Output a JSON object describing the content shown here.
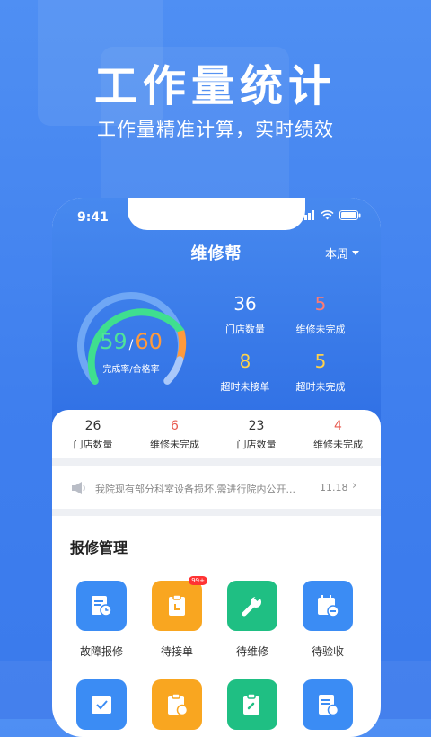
{
  "hero": {
    "title": "工作量统计",
    "subtitle": "工作量精准计算，实时绩效"
  },
  "status": {
    "time": "9:41"
  },
  "app": {
    "title": "维修帮",
    "period": "本周"
  },
  "gauge": {
    "done": "59",
    "sep": "/",
    "ok": "60",
    "label": "完成率/合格率",
    "done_fraction": 0.59,
    "ok_fraction": 0.6
  },
  "stats": [
    {
      "value": "36",
      "label": "门店数量"
    },
    {
      "value": "5",
      "label": "维修未完成"
    },
    {
      "value": "8",
      "label": "超时未接单"
    },
    {
      "value": "5",
      "label": "超时未完成"
    }
  ],
  "summary": [
    {
      "value": "26",
      "label": "门店数量"
    },
    {
      "value": "6",
      "label": "维修未完成"
    },
    {
      "value": "23",
      "label": "门店数量"
    },
    {
      "value": "4",
      "label": "维修未完成"
    }
  ],
  "notice": {
    "text": "我院现有部分科室设备损坏,需进行院内公开...",
    "date": "11.18",
    "icon": "megaphone-icon"
  },
  "section": {
    "title": "报修管理"
  },
  "grid": [
    {
      "label": "故障报修",
      "icon": "report-icon",
      "color": "#3b8cf4"
    },
    {
      "label": "待接单",
      "icon": "clipboard-icon",
      "color": "#f9a620",
      "badge": "99+"
    },
    {
      "label": "待维修",
      "icon": "wrench-icon",
      "color": "#1fbf83"
    },
    {
      "label": "待验收",
      "icon": "calendar-check-icon",
      "color": "#3b8cf4"
    }
  ],
  "colors": {
    "accent": "#3f7fee",
    "gauge_green": "#4fe39a",
    "gauge_orange": "#ff9a3c",
    "alert_red": "#e85a4f",
    "warning_yellow": "#ffd24a"
  }
}
